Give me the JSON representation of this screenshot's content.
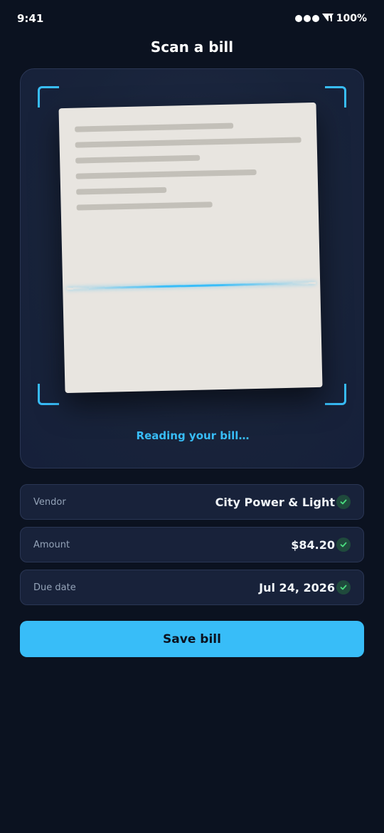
{
  "status_bar": {
    "time": "9:41",
    "battery": "100%",
    "icons": [
      "signal-dots-icon",
      "wifi-icon"
    ]
  },
  "header": {
    "title": "Scan a bill"
  },
  "scanner": {
    "status_text": "Reading your bill…",
    "accent_color": "#38bdf8"
  },
  "fields": [
    {
      "label": "Vendor",
      "value": "City Power & Light",
      "verified": true
    },
    {
      "label": "Amount",
      "value": "$84.20",
      "verified": true
    },
    {
      "label": "Due date",
      "value": "Jul 24, 2026",
      "verified": true
    }
  ],
  "actions": {
    "save_label": "Save bill"
  },
  "colors": {
    "background": "#0b1220",
    "accent": "#38bdf8",
    "card": "#18223a",
    "verified": "#4ade80"
  }
}
